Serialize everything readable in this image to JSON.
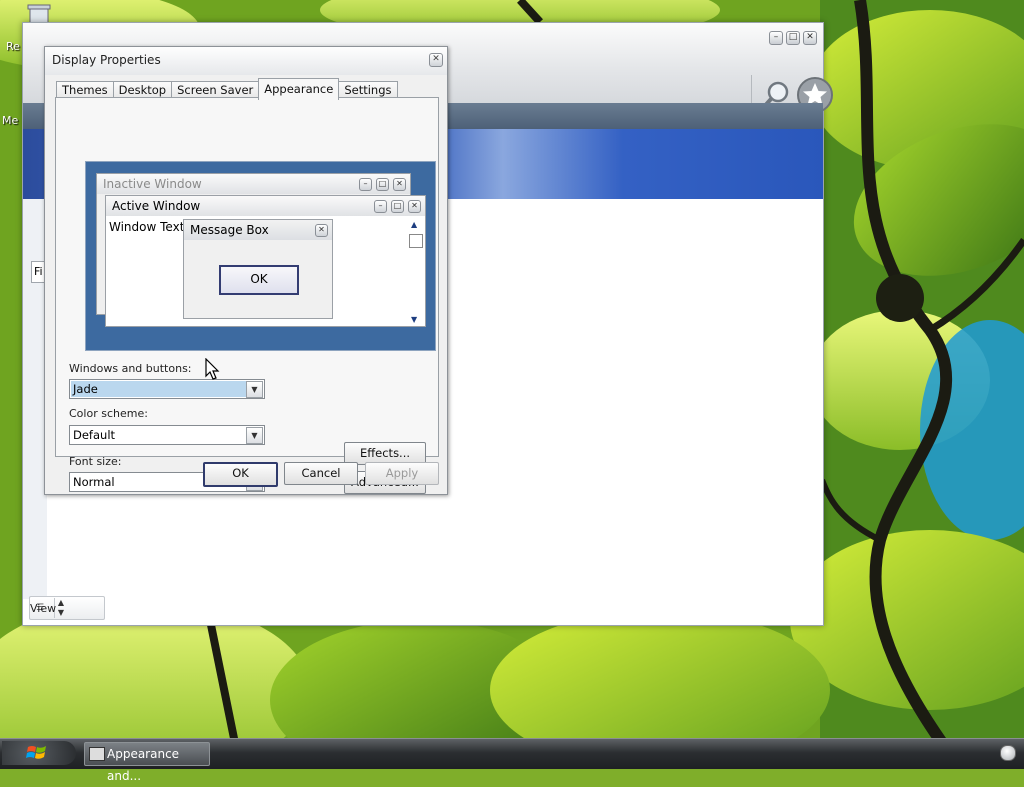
{
  "desktop": {
    "icon_labels": [
      "Re",
      "Me"
    ]
  },
  "explorer": {
    "file_button": "Fi",
    "view_button": "View"
  },
  "dialog": {
    "title": "Display Properties",
    "close_glyph": "✕",
    "tabs": [
      "Themes",
      "Desktop",
      "Screen Saver",
      "Appearance",
      "Settings"
    ],
    "active_tab": "Appearance",
    "preview": {
      "inactive_title": "Inactive Window",
      "active_title": "Active Window",
      "window_text": "Window Text",
      "message_box_title": "Message Box",
      "message_box_ok": "OK"
    },
    "windows_and_buttons": {
      "label": "Windows and buttons:",
      "value": "Jade"
    },
    "color_scheme": {
      "label": "Color scheme:",
      "value": "Default"
    },
    "font_size": {
      "label": "Font size:",
      "value": "Normal"
    },
    "effects_button": "Effects...",
    "advanced_button": "Advanced...",
    "ok_button": "OK",
    "cancel_button": "Cancel",
    "apply_button": "Apply"
  },
  "taskbar": {
    "item_label": "Appearance and..."
  },
  "colors": {
    "preview_background": "#3d6aa0",
    "selection": "#bad7ee",
    "banner_blue": "#2c4c9c",
    "taskbar": "#2b2e31"
  }
}
